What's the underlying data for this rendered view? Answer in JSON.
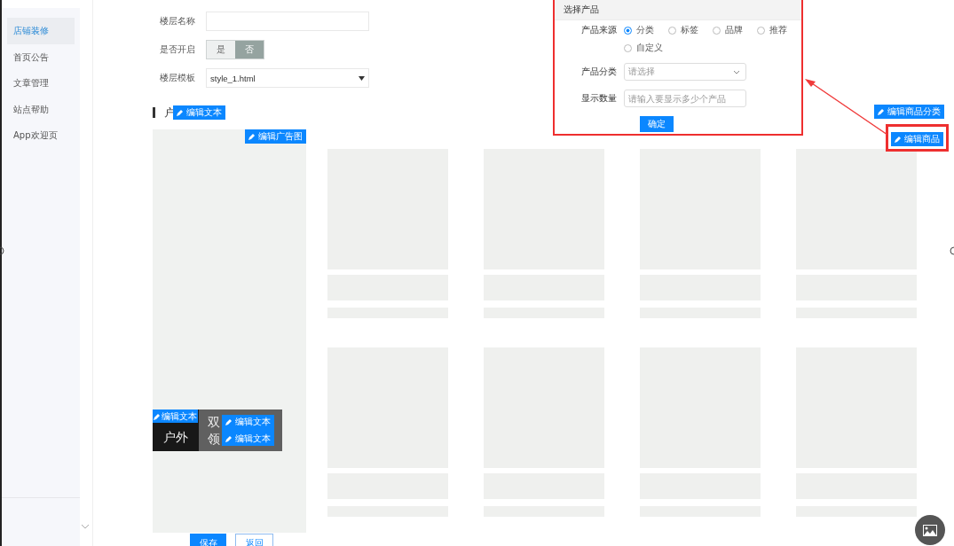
{
  "sidebar": {
    "items": [
      {
        "label": "店铺装修",
        "selected": true
      },
      {
        "label": "首页公告",
        "selected": false
      },
      {
        "label": "文章管理",
        "selected": false
      },
      {
        "label": "站点帮助",
        "selected": false
      },
      {
        "label": "App欢迎页",
        "selected": false
      }
    ]
  },
  "form": {
    "floor_name": {
      "label": "楼层名称"
    },
    "enabled": {
      "label": "是否开启",
      "options": [
        {
          "label": "是",
          "selected": false
        },
        {
          "label": "否",
          "selected": true
        }
      ]
    },
    "template": {
      "label": "楼层模板",
      "value": "style_1.html"
    }
  },
  "section": {
    "title": "户",
    "edit_button": "编辑文本"
  },
  "ad": {
    "edit_button": "编辑广告图",
    "tiles": [
      {
        "kind": "dark",
        "lines": [
          "户外"
        ],
        "edit_buttons": [
          "编辑文本"
        ]
      },
      {
        "kind": "grey",
        "lines": [
          "双",
          "领"
        ],
        "edit_buttons": [
          "编辑文本",
          "编辑文本"
        ]
      }
    ]
  },
  "products": [
    {
      "kind": "placeholder"
    },
    {
      "kind": "placeholder"
    },
    {
      "kind": "placeholder"
    },
    {
      "kind": "placeholder"
    },
    {
      "kind": "placeholder"
    },
    {
      "kind": "placeholder"
    },
    {
      "kind": "placeholder"
    },
    {
      "kind": "placeholder"
    }
  ],
  "category_edit_button": "编辑商品分类",
  "product_edit_button": {
    "label": "编辑商品",
    "highlighted": true
  },
  "popup": {
    "title": "选择产品",
    "source": {
      "label": "产品来源",
      "options": [
        {
          "label": "分类",
          "selected": true
        },
        {
          "label": "标签",
          "selected": false
        },
        {
          "label": "品牌",
          "selected": false
        },
        {
          "label": "推荐",
          "selected": false
        },
        {
          "label": "自定义",
          "selected": false
        }
      ]
    },
    "category": {
      "label": "产品分类",
      "placeholder": "请选择"
    },
    "count": {
      "label": "显示数量",
      "placeholder": "请输入要显示多少个产品"
    },
    "confirm": "确定"
  },
  "actions": {
    "save": "保存",
    "back": "返回"
  }
}
